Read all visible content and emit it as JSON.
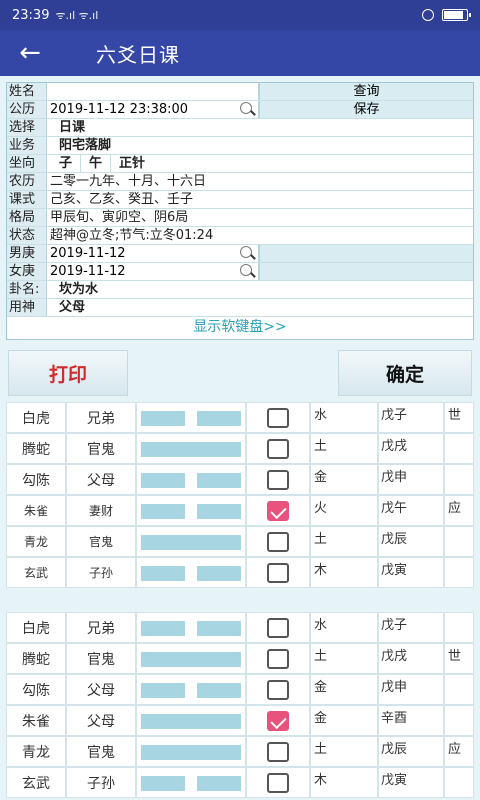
{
  "status": {
    "time": "23:39",
    "signal": "ᯤ.ıl ᯤ.ıl",
    "battery_level": 0.85
  },
  "appbar": {
    "back_icon": "←",
    "title": "六爻日课"
  },
  "form": {
    "name_label": "姓名",
    "name_value": "",
    "query_button": "查询",
    "gongli_label": "公历",
    "gongli_value": "2019-11-12 23:38:00",
    "save_button": "保存",
    "select_label": "选择",
    "select_value": "日课",
    "business_label": "业务",
    "business_value": "阳宅落脚",
    "zuoxiang_label": "坐向",
    "zuo": "子",
    "xiang": "午",
    "zhen": "正针",
    "nongli_label": "农历",
    "nongli_value": "二零一九年、十月、十六日",
    "keshi_label": "课式",
    "keshi_value": "己亥、乙亥、癸丑、壬子",
    "geju_label": "格局",
    "geju_value": "甲辰旬、寅卯空、阴6局",
    "zhuangtai_label": "状态",
    "zhuangtai_value": "超神@立冬;节气:立冬01:24",
    "nangeng_label": "男庚",
    "nangeng_value": "2019-11-12",
    "nvgeng_label": "女庚",
    "nvgeng_value": "2019-11-12",
    "gua_label": "卦名:",
    "gua_value": "坎为水",
    "yongshen_label": "用神",
    "yongshen_value": "父母",
    "keyboard_link": "显示软键盘>>"
  },
  "actions": {
    "print": "打印",
    "confirm": "确定"
  },
  "hexagram1": [
    {
      "god": "白虎",
      "rel": "兄弟",
      "yang": false,
      "checked": false,
      "elem": "水",
      "gz": "戊子",
      "mark": "世"
    },
    {
      "god": "腾蛇",
      "rel": "官鬼",
      "yang": true,
      "checked": false,
      "elem": "土",
      "gz": "戊戌",
      "mark": ""
    },
    {
      "god": "勾陈",
      "rel": "父母",
      "yang": false,
      "checked": false,
      "elem": "金",
      "gz": "戊申",
      "mark": ""
    },
    {
      "god": "朱雀",
      "rel": "妻财",
      "yang": false,
      "checked": true,
      "elem": "火",
      "gz": "戊午",
      "mark": "应"
    },
    {
      "god": "青龙",
      "rel": "官鬼",
      "yang": true,
      "checked": false,
      "elem": "土",
      "gz": "戊辰",
      "mark": ""
    },
    {
      "god": "玄武",
      "rel": "子孙",
      "yang": false,
      "checked": false,
      "elem": "木",
      "gz": "戊寅",
      "mark": ""
    }
  ],
  "hexagram2": [
    {
      "god": "白虎",
      "rel": "兄弟",
      "yang": false,
      "checked": false,
      "elem": "水",
      "gz": "戊子",
      "mark": ""
    },
    {
      "god": "腾蛇",
      "rel": "官鬼",
      "yang": true,
      "checked": false,
      "elem": "土",
      "gz": "戊戌",
      "mark": "世"
    },
    {
      "god": "勾陈",
      "rel": "父母",
      "yang": false,
      "checked": false,
      "elem": "金",
      "gz": "戊申",
      "mark": ""
    },
    {
      "god": "朱雀",
      "rel": "父母",
      "yang": true,
      "checked": true,
      "elem": "金",
      "gz": "辛酉",
      "mark": ""
    },
    {
      "god": "青龙",
      "rel": "官鬼",
      "yang": true,
      "checked": false,
      "elem": "土",
      "gz": "戊辰",
      "mark": "应"
    },
    {
      "god": "玄武",
      "rel": "子孙",
      "yang": false,
      "checked": false,
      "elem": "木",
      "gz": "戊寅",
      "mark": ""
    }
  ]
}
